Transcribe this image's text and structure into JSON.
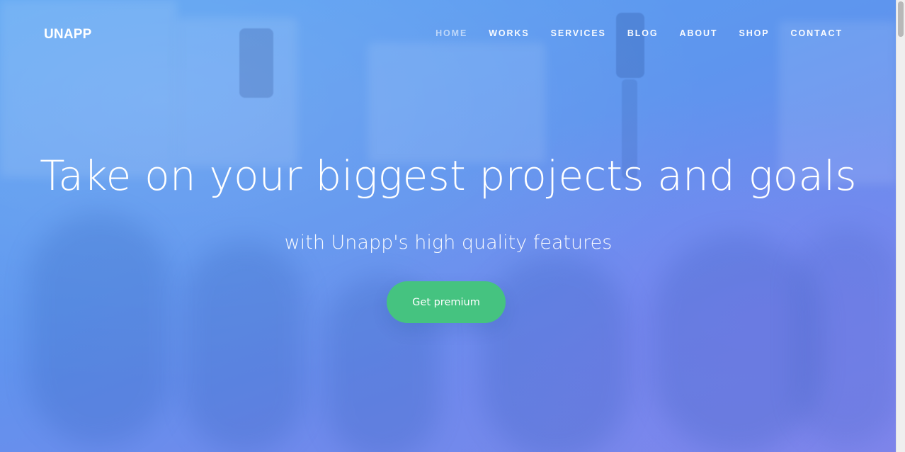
{
  "brand": {
    "name": "UNAPP"
  },
  "nav": {
    "items": [
      {
        "label": "HOME",
        "active": true
      },
      {
        "label": "WORKS",
        "active": false
      },
      {
        "label": "SERVICES",
        "active": false
      },
      {
        "label": "BLOG",
        "active": false
      },
      {
        "label": "ABOUT",
        "active": false
      },
      {
        "label": "SHOP",
        "active": false
      },
      {
        "label": "CONTACT",
        "active": false
      }
    ]
  },
  "hero": {
    "headline": "Take on your biggest projects and goals",
    "subheadline": "with Unapp's high quality features",
    "cta_label": "Get premium"
  },
  "colors": {
    "overlay_start": "#5aa4f2",
    "overlay_end": "#7c86ea",
    "cta_green": "#45c380",
    "text": "#ffffff"
  }
}
